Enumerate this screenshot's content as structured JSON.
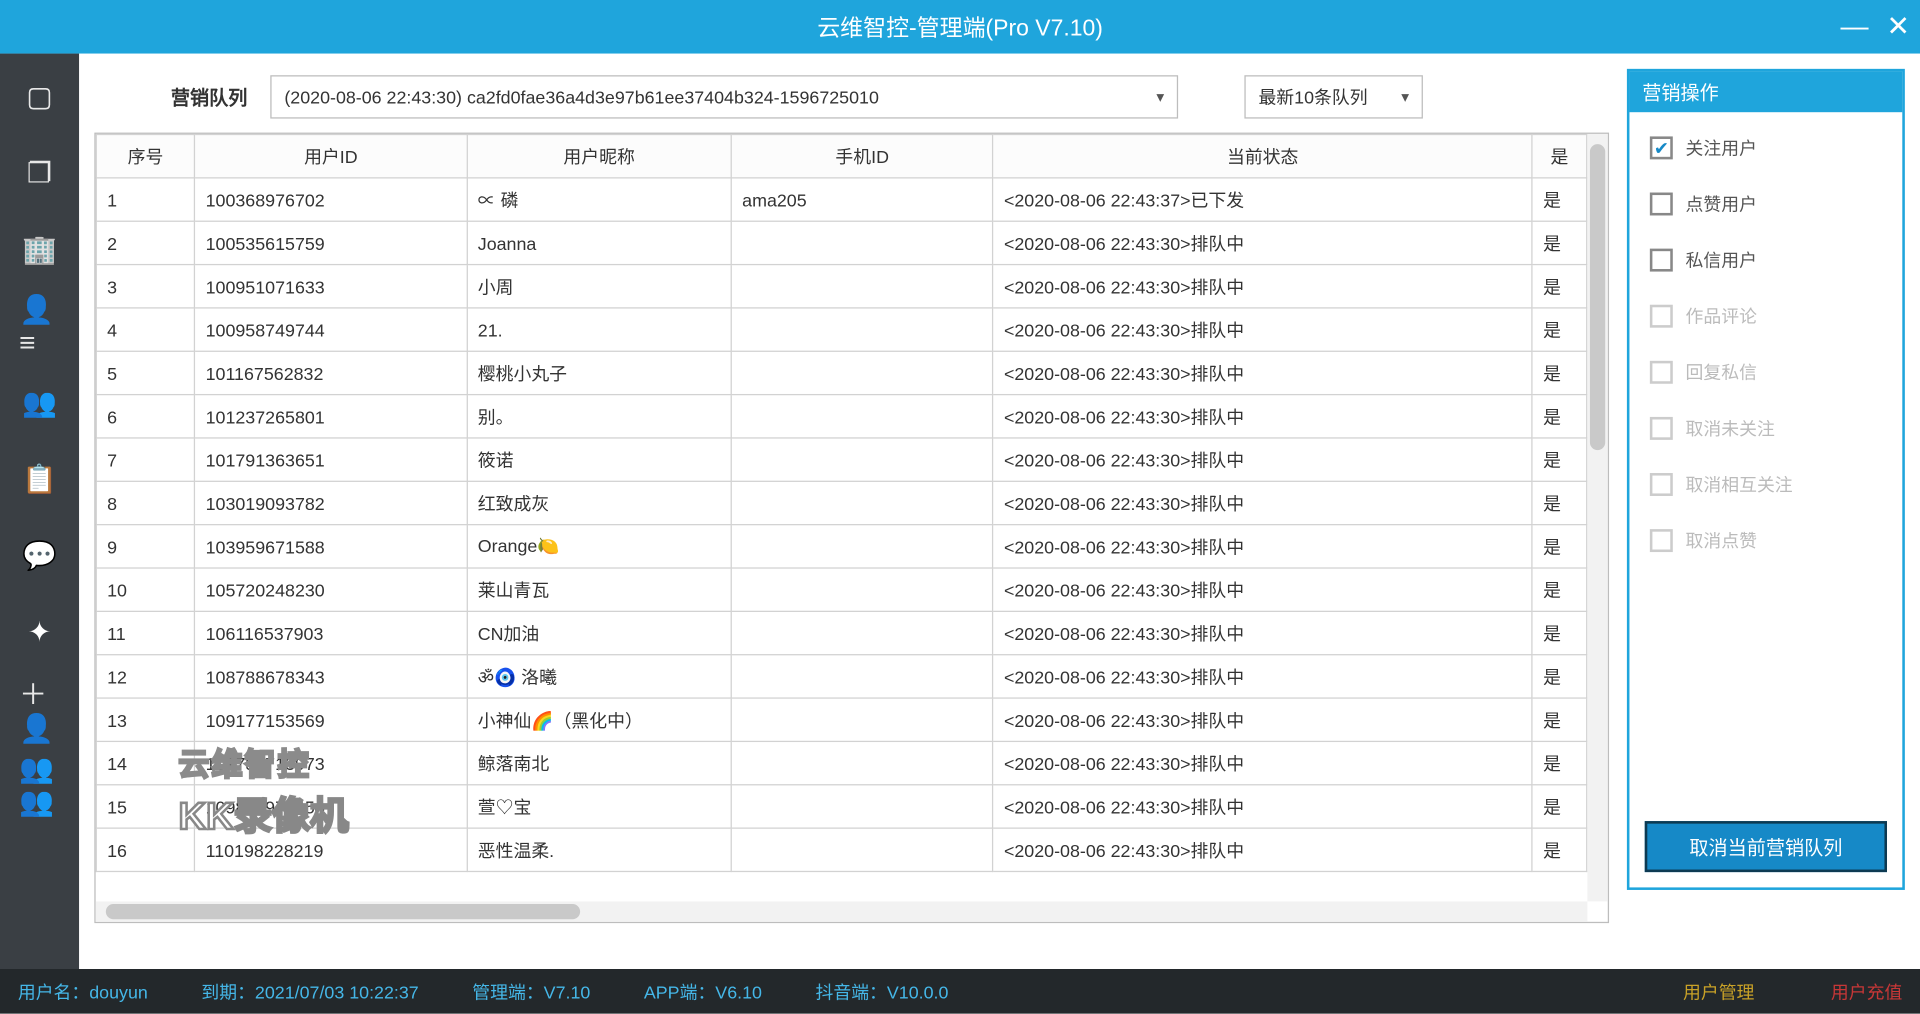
{
  "window": {
    "title": "云维智控-管理端(Pro V7.10)"
  },
  "toolbar": {
    "queue_label": "营销队列",
    "queue_value": "(2020-08-06 22:43:30) ca2fd0fae36a4d3e97b61ee37404b324-1596725010",
    "recent_value": "最新10条队列"
  },
  "columns": {
    "seq": "序号",
    "uid": "用户ID",
    "nick": "用户昵称",
    "phone": "手机ID",
    "status": "当前状态",
    "flag": "是"
  },
  "rows": [
    {
      "seq": "1",
      "uid": "100368976702",
      "nick": "∝ 磷",
      "phone": "ama205",
      "status": "<2020-08-06 22:43:37>已下发",
      "flag": "是"
    },
    {
      "seq": "2",
      "uid": "100535615759",
      "nick": "Joanna",
      "phone": "",
      "status": "<2020-08-06 22:43:30>排队中",
      "flag": "是"
    },
    {
      "seq": "3",
      "uid": "100951071633",
      "nick": "小周",
      "phone": "",
      "status": "<2020-08-06 22:43:30>排队中",
      "flag": "是"
    },
    {
      "seq": "4",
      "uid": "100958749744",
      "nick": "21.",
      "phone": "",
      "status": "<2020-08-06 22:43:30>排队中",
      "flag": "是"
    },
    {
      "seq": "5",
      "uid": "101167562832",
      "nick": "樱桃小丸子",
      "phone": "",
      "status": "<2020-08-06 22:43:30>排队中",
      "flag": "是"
    },
    {
      "seq": "6",
      "uid": "101237265801",
      "nick": "别。",
      "phone": "",
      "status": "<2020-08-06 22:43:30>排队中",
      "flag": "是"
    },
    {
      "seq": "7",
      "uid": "101791363651",
      "nick": "筱诺",
      "phone": "",
      "status": "<2020-08-06 22:43:30>排队中",
      "flag": "是"
    },
    {
      "seq": "8",
      "uid": "103019093782",
      "nick": "红致成灰",
      "phone": "",
      "status": "<2020-08-06 22:43:30>排队中",
      "flag": "是"
    },
    {
      "seq": "9",
      "uid": "103959671588",
      "nick": "Orange🍋",
      "phone": "",
      "status": "<2020-08-06 22:43:30>排队中",
      "flag": "是"
    },
    {
      "seq": "10",
      "uid": "105720248230",
      "nick": "莱山青瓦",
      "phone": "",
      "status": "<2020-08-06 22:43:30>排队中",
      "flag": "是"
    },
    {
      "seq": "11",
      "uid": "106116537903",
      "nick": "CN加油",
      "phone": "",
      "status": "<2020-08-06 22:43:30>排队中",
      "flag": "是"
    },
    {
      "seq": "12",
      "uid": "108788678343",
      "nick": "ॐ🧿 洛曦",
      "phone": "",
      "status": "<2020-08-06 22:43:30>排队中",
      "flag": "是"
    },
    {
      "seq": "13",
      "uid": "109177153569",
      "nick": "小神仙🌈（黑化中）",
      "phone": "",
      "status": "<2020-08-06 22:43:30>排队中",
      "flag": "是"
    },
    {
      "seq": "14",
      "uid": "109786713973",
      "nick": "鲸落南北",
      "phone": "",
      "status": "<2020-08-06 22:43:30>排队中",
      "flag": "是"
    },
    {
      "seq": "15",
      "uid": "109817974454",
      "nick": "萱♡宝",
      "phone": "",
      "status": "<2020-08-06 22:43:30>排队中",
      "flag": "是"
    },
    {
      "seq": "16",
      "uid": "110198228219",
      "nick": "恶性温柔.",
      "phone": "",
      "status": "<2020-08-06 22:43:30>排队中",
      "flag": "是"
    }
  ],
  "panel": {
    "title": "营销操作",
    "chk_follow": "关注用户",
    "chk_like": "点赞用户",
    "chk_dm": "私信用户",
    "chk_comment": "作品评论",
    "chk_reply": "回复私信",
    "chk_unfollow1": "取消未关注",
    "chk_unfollow2": "取消相互关注",
    "chk_unlike": "取消点赞",
    "cancel_btn": "取消当前营销队列"
  },
  "status": {
    "user_label": "用户名：",
    "user_value": "douyun",
    "expire_label": "到期：",
    "expire_value": "2021/07/03 10:22:37",
    "mgr_label": "管理端：",
    "mgr_value": "V7.10",
    "app_label": "APP端：",
    "app_value": "V6.10",
    "dy_label": "抖音端：",
    "dy_value": "V10.0.0",
    "link1": "用户管理",
    "link2": "用户充值"
  },
  "watermark": {
    "line1": "云维智控",
    "line2": "KK录像机"
  }
}
